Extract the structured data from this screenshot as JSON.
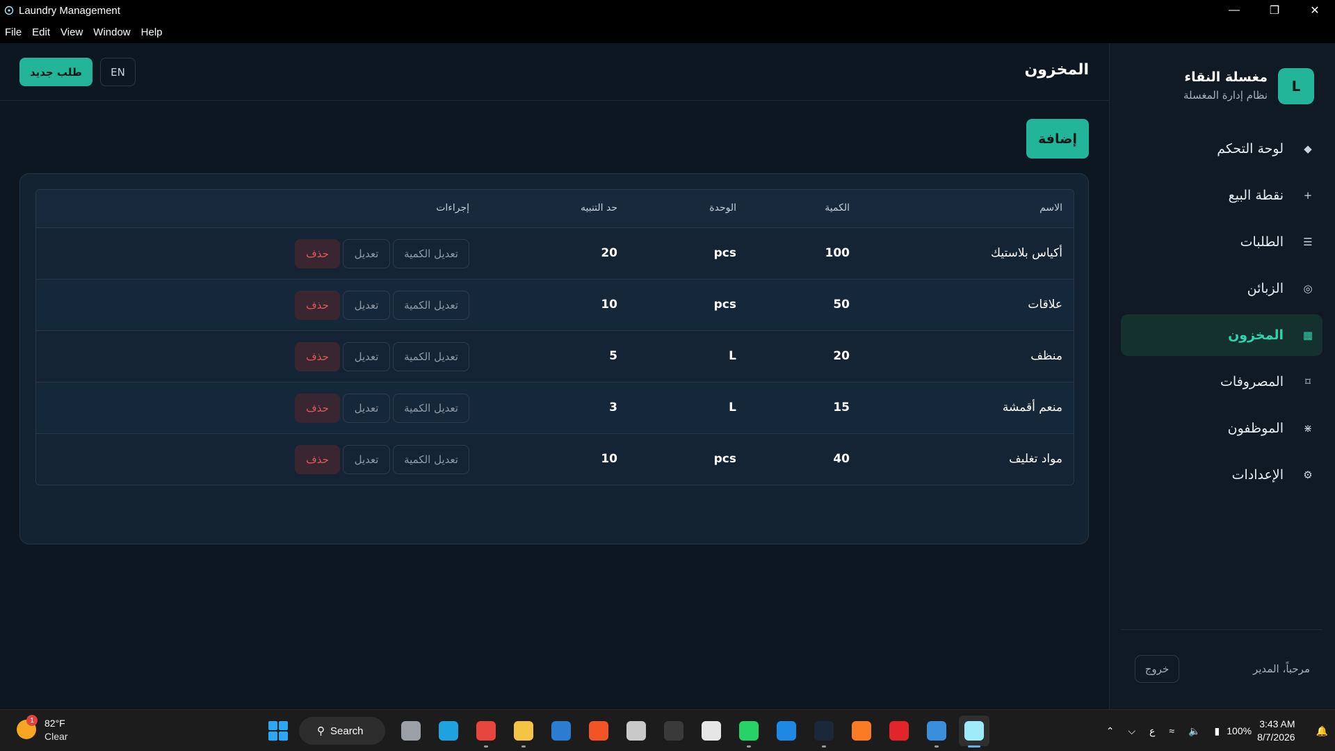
{
  "window": {
    "title": "Laundry Management",
    "controls": {
      "minimize": "—",
      "restore": "❐",
      "close": "✕"
    }
  },
  "menu": [
    "File",
    "Edit",
    "View",
    "Window",
    "Help"
  ],
  "brand": {
    "logo_letter": "L",
    "name": "مغسلة النقاء",
    "subtitle": "نظام إدارة المغسلة"
  },
  "nav": [
    {
      "label": "لوحة التحكم",
      "icon": "◆",
      "active": false
    },
    {
      "label": "نقطة البيع",
      "icon": "+",
      "active": false
    },
    {
      "label": "الطلبات",
      "icon": "☰",
      "active": false
    },
    {
      "label": "الزبائن",
      "icon": "◎",
      "active": false
    },
    {
      "label": "المخزون",
      "icon": "▦",
      "active": true
    },
    {
      "label": "المصروفات",
      "icon": "⌑",
      "active": false
    },
    {
      "label": "الموظفون",
      "icon": "⋇",
      "active": false
    },
    {
      "label": "الإعدادات",
      "icon": "⚙",
      "active": false
    }
  ],
  "sidebar_footer": {
    "welcome": "مرحباً، المدير",
    "logout": "خروج"
  },
  "topbar": {
    "new_order": "طلب جديد",
    "lang": "EN",
    "title": "المخزون"
  },
  "add_button": "إضافة",
  "table": {
    "headers": {
      "name": "الاسم",
      "qty": "الكمية",
      "unit": "الوحدة",
      "alert": "حد التنبيه",
      "actions": "إجراءات"
    },
    "action_labels": {
      "adjust_qty": "تعديل الكمية",
      "edit": "تعديل",
      "delete": "حذف"
    },
    "rows": [
      {
        "name": "أكياس بلاستيك",
        "qty": "100",
        "unit": "pcs",
        "alert": "20"
      },
      {
        "name": "علاقات",
        "qty": "50",
        "unit": "pcs",
        "alert": "10"
      },
      {
        "name": "منظف",
        "qty": "20",
        "unit": "L",
        "alert": "5"
      },
      {
        "name": "منعم أقمشة",
        "qty": "15",
        "unit": "L",
        "alert": "3"
      },
      {
        "name": "مواد تغليف",
        "qty": "40",
        "unit": "pcs",
        "alert": "10"
      }
    ]
  },
  "taskbar": {
    "weather": {
      "temp": "82°F",
      "condition": "Clear",
      "badge": "1"
    },
    "search_label": "Search",
    "apps": [
      {
        "name": "task-view-icon",
        "color": "#9aa0a6",
        "active": false,
        "running": false
      },
      {
        "name": "edge-icon",
        "color": "#1fa2e0",
        "active": false,
        "running": false
      },
      {
        "name": "chrome-icon",
        "color": "#e8453c",
        "active": false,
        "running": true
      },
      {
        "name": "file-explorer-icon",
        "color": "#f6c445",
        "active": false,
        "running": true
      },
      {
        "name": "outlook-icon",
        "color": "#2b7cd3",
        "active": false,
        "running": false
      },
      {
        "name": "store-icon",
        "color": "#f35325",
        "active": false,
        "running": false
      },
      {
        "name": "mail-icon",
        "color": "#c9c9c9",
        "active": false,
        "running": false
      },
      {
        "name": "cube-app-icon",
        "color": "#3a3a3a",
        "active": false,
        "running": false
      },
      {
        "name": "chatgpt-icon",
        "color": "#e6e6e6",
        "active": false,
        "running": false
      },
      {
        "name": "whatsapp-icon",
        "color": "#25d366",
        "active": false,
        "running": true
      },
      {
        "name": "remote-app-icon",
        "color": "#1e88e5",
        "active": false,
        "running": false
      },
      {
        "name": "steam-icon",
        "color": "#1b2838",
        "active": false,
        "running": true
      },
      {
        "name": "xampp-icon",
        "color": "#fb7a24",
        "active": false,
        "running": false
      },
      {
        "name": "wps-icon",
        "color": "#e3242b",
        "active": false,
        "running": false
      },
      {
        "name": "photos-icon",
        "color": "#3b8edb",
        "active": false,
        "running": true
      },
      {
        "name": "electron-app-icon",
        "color": "#9feaf9",
        "active": true,
        "running": true
      }
    ],
    "tray": {
      "lang_indicator": "ع",
      "battery": "100%",
      "time": "3:43 AM",
      "date": "8/7/2026"
    }
  }
}
